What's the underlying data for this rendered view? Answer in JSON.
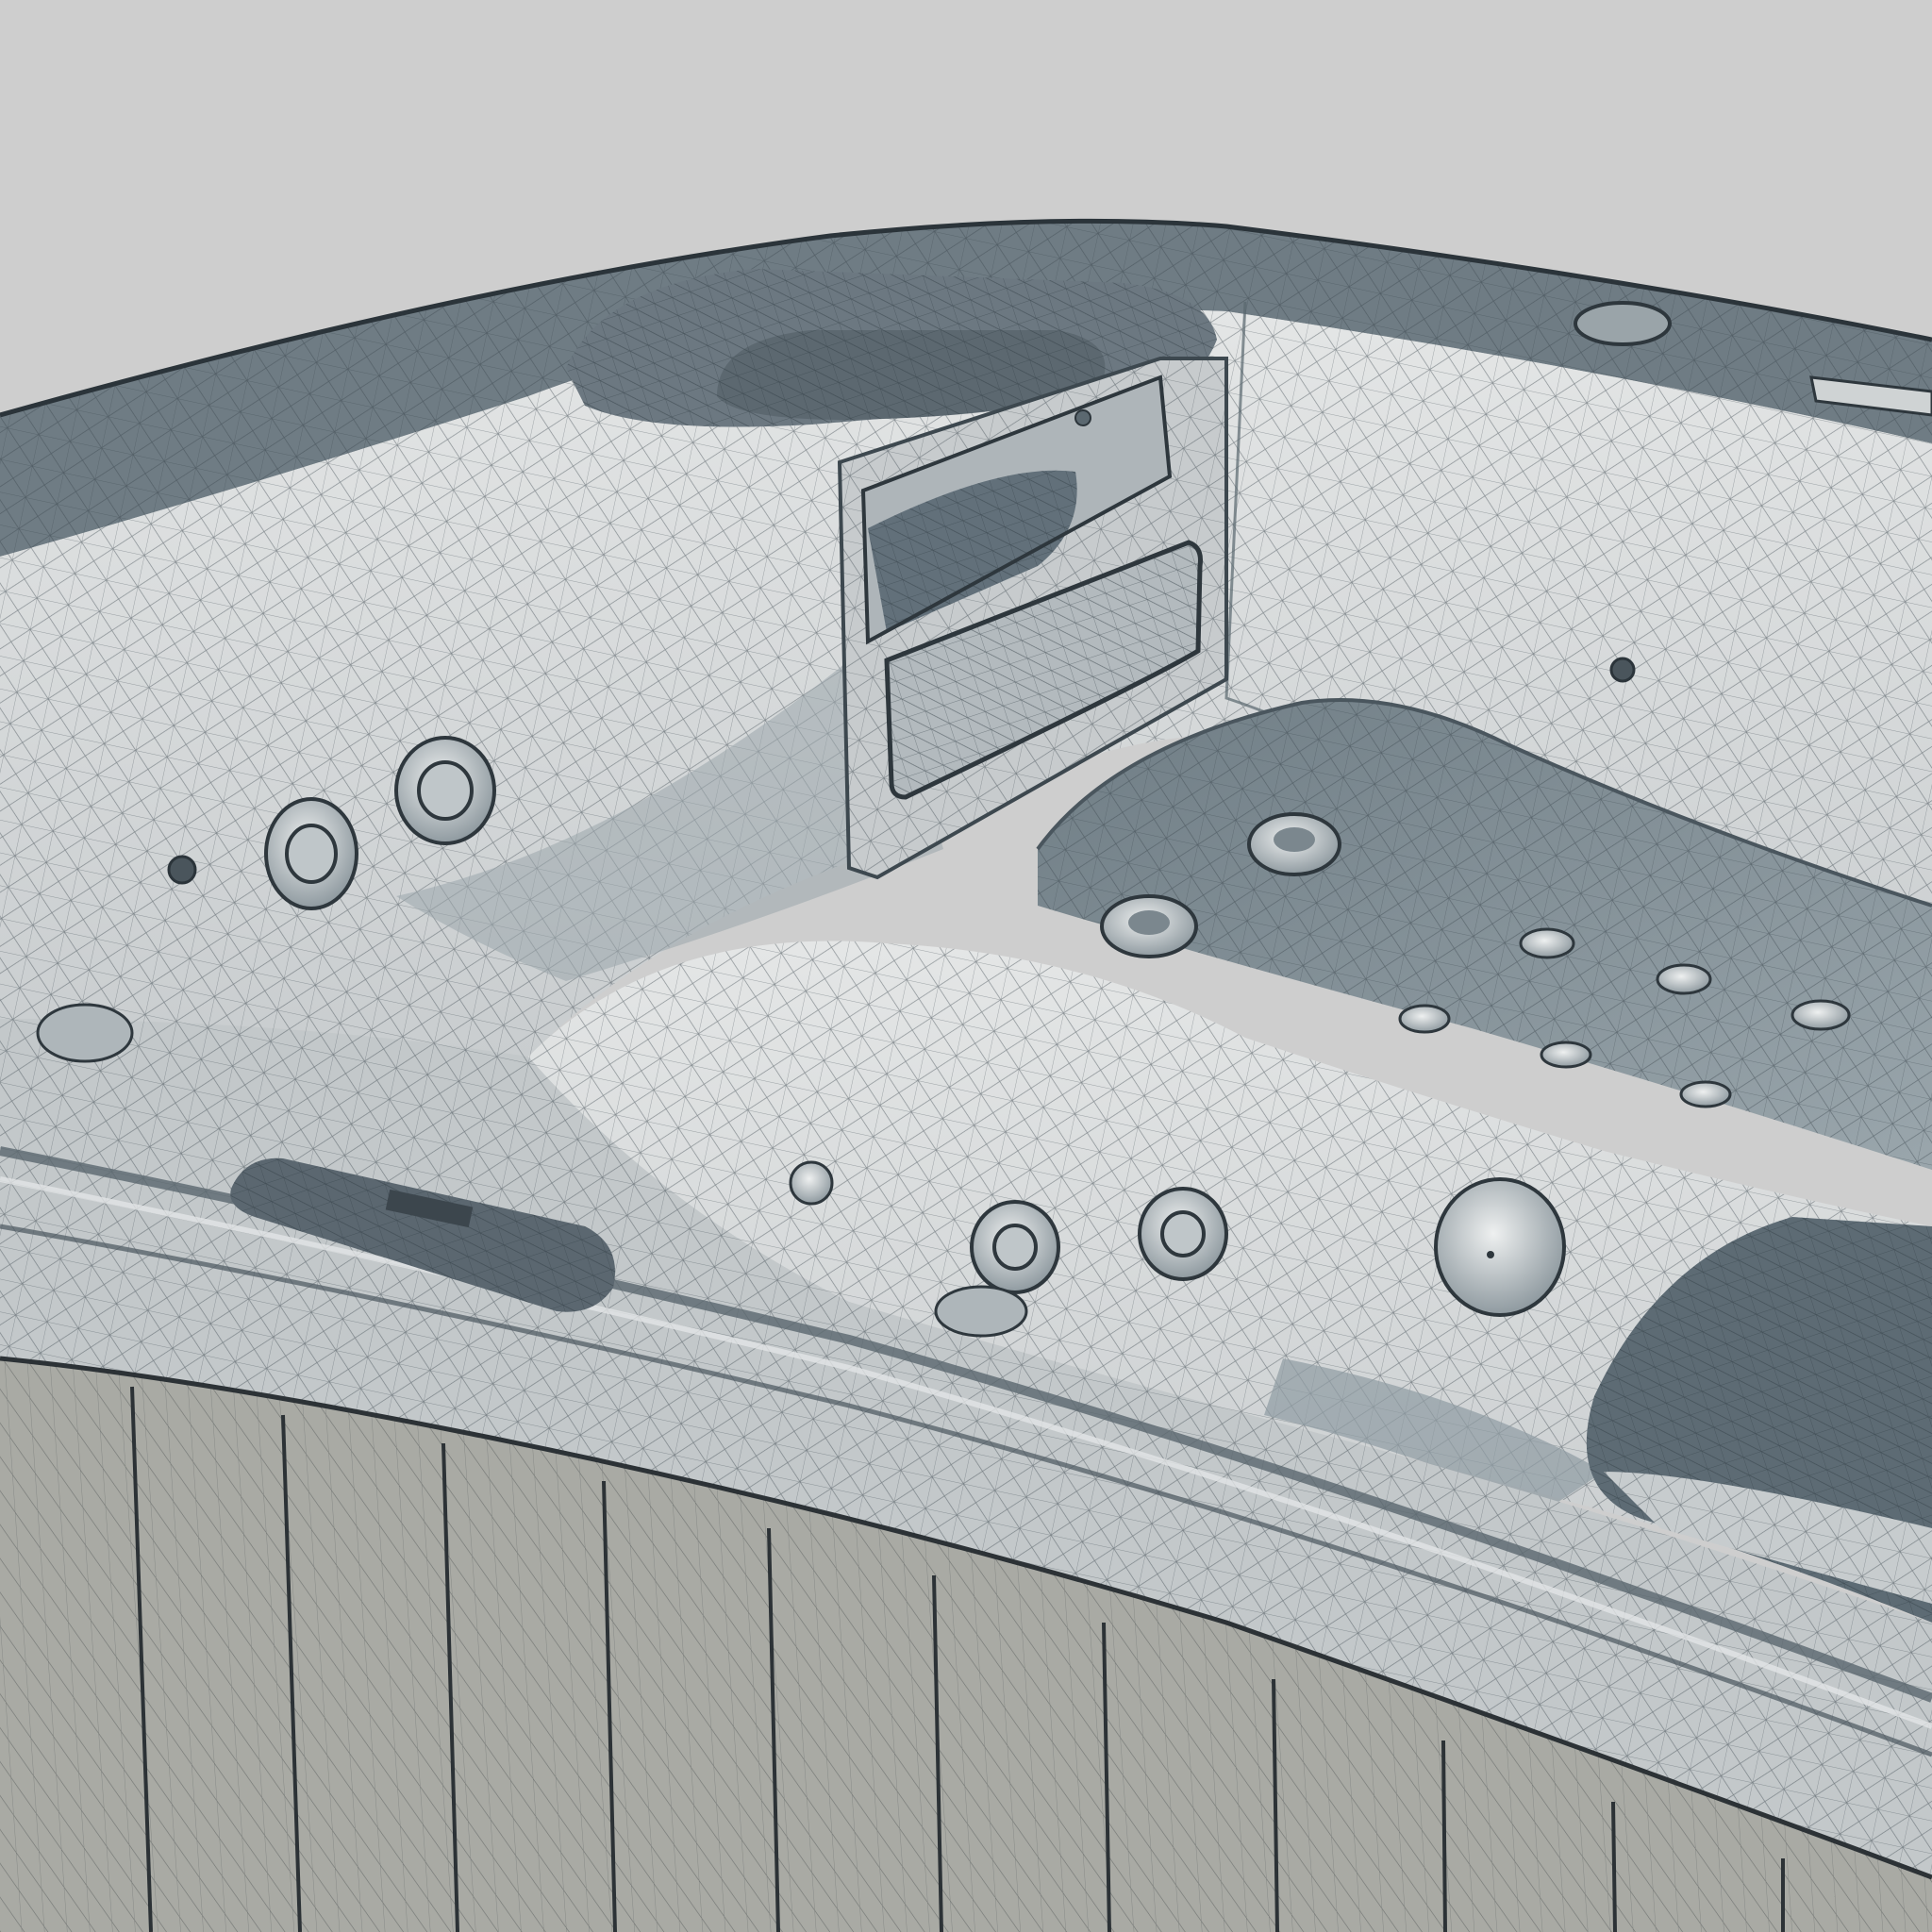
{
  "scene": {
    "subject": "hot-tub-wireframe-render",
    "colors": {
      "background": "#cecece",
      "shell": "#d6d8d8",
      "shell_shadow": "#8e9aa0",
      "shell_dark": "#5f6d75",
      "wire": "#3a454c",
      "skirt": "#a9aaa4",
      "skirt_line": "#2c3236"
    },
    "parts": [
      "top-rim",
      "left-headrest-pillow",
      "filter-housing",
      "filter-opening",
      "control-panel-recess",
      "inner-wall",
      "left-seat",
      "lounger-seat",
      "front-rim",
      "front-headrest-pillow",
      "cabinet-skirt",
      "wall-jet",
      "air-jet",
      "drain"
    ]
  }
}
